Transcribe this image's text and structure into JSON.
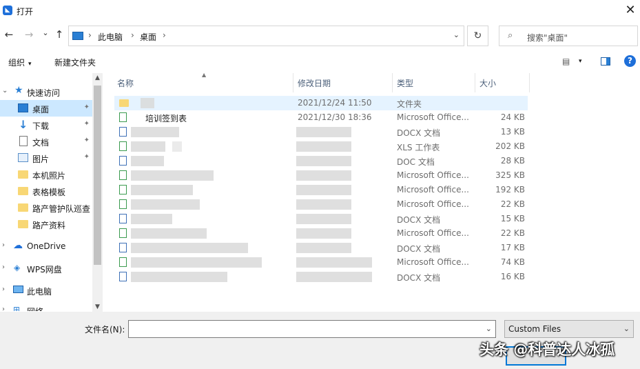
{
  "window": {
    "title": "打开",
    "close_glyph": "✕"
  },
  "nav": {
    "back": "←",
    "forward": "→",
    "recent": "⌄",
    "up": "↑"
  },
  "address": {
    "crumbs": [
      "此电脑",
      "桌面"
    ],
    "sep": "›",
    "dropdown": "⌄",
    "refresh": "↻"
  },
  "search": {
    "icon": "⌕",
    "placeholder": "搜索\"桌面\""
  },
  "toolbar": {
    "organize": "组织",
    "new_folder": "新建文件夹",
    "caret": "▾",
    "view_glyph": "▤",
    "help": "?"
  },
  "sidebar": {
    "items": [
      {
        "label": "快速访问",
        "icon": "star-icon",
        "chev": "⌄"
      },
      {
        "label": "桌面",
        "icon": "desktop-icon",
        "pin": "✦"
      },
      {
        "label": "下载",
        "icon": "download-icon",
        "glyph": "↓",
        "pin": "✦"
      },
      {
        "label": "文档",
        "icon": "document-icon",
        "pin": "✦"
      },
      {
        "label": "图片",
        "icon": "picture-icon",
        "pin": "✦"
      },
      {
        "label": "本机照片",
        "icon": "folder-icon"
      },
      {
        "label": "表格模板",
        "icon": "folder-icon"
      },
      {
        "label": "路产管护队巡查",
        "icon": "folder-icon"
      },
      {
        "label": "路产资料",
        "icon": "folder-icon"
      },
      {
        "label": "OneDrive",
        "icon": "cloud-icon",
        "chev": "›"
      },
      {
        "label": "WPS网盘",
        "icon": "wps-cloud-icon",
        "chev": "›"
      },
      {
        "label": "此电脑",
        "icon": "computer-icon",
        "chev": "›"
      },
      {
        "label": "网络",
        "icon": "network-icon",
        "chev": "›"
      }
    ],
    "star_glyph": "★",
    "cloud_glyph": "☁",
    "wps_glyph": "◈",
    "net_glyph": "⊞"
  },
  "columns": {
    "name": "名称",
    "date": "修改日期",
    "type": "类型",
    "size": "大小"
  },
  "files": [
    {
      "name": "",
      "date": "2021/12/24 11:50",
      "type": "文件夹",
      "size": "",
      "icon": "folder-icon"
    },
    {
      "name": "培训签到表",
      "date": "2021/12/30 18:36",
      "type": "Microsoft Office...",
      "size": "24 KB",
      "icon": "xls-icon"
    },
    {
      "name": "",
      "date": "",
      "type": "DOCX 文档",
      "size": "13 KB",
      "icon": "doc-icon"
    },
    {
      "name": "",
      "date": "",
      "type": "XLS 工作表",
      "size": "202 KB",
      "icon": "xls-icon"
    },
    {
      "name": "",
      "date": "",
      "type": "DOC 文档",
      "size": "28 KB",
      "icon": "doc-icon"
    },
    {
      "name": "",
      "date": "",
      "type": "Microsoft Office...",
      "size": "325 KB",
      "icon": "xls-icon"
    },
    {
      "name": "",
      "date": "",
      "type": "Microsoft Office...",
      "size": "192 KB",
      "icon": "xls-icon"
    },
    {
      "name": "",
      "date": "",
      "type": "Microsoft Office...",
      "size": "22 KB",
      "icon": "xls-icon"
    },
    {
      "name": "",
      "date": "",
      "type": "DOCX 文档",
      "size": "15 KB",
      "icon": "doc-icon"
    },
    {
      "name": "",
      "date": "",
      "type": "Microsoft Office...",
      "size": "22 KB",
      "icon": "xls-icon"
    },
    {
      "name": "",
      "date": "",
      "type": "DOCX 文档",
      "size": "17 KB",
      "icon": "doc-icon"
    },
    {
      "name": "",
      "date": "",
      "type": "Microsoft Office...",
      "size": "74 KB",
      "icon": "xls-icon"
    },
    {
      "name": "",
      "date": "",
      "type": "DOCX 文档",
      "size": "16 KB",
      "icon": "doc-icon"
    }
  ],
  "bottom": {
    "filename_label": "文件名(N):",
    "filename_value": "",
    "filter_value": "Custom Files",
    "dropdown": "⌄"
  },
  "watermark": "头条 @科普达人冰孤",
  "colors": {
    "accent": "#0078d7",
    "selection": "#cce8ff",
    "hover": "#e5f3ff"
  }
}
